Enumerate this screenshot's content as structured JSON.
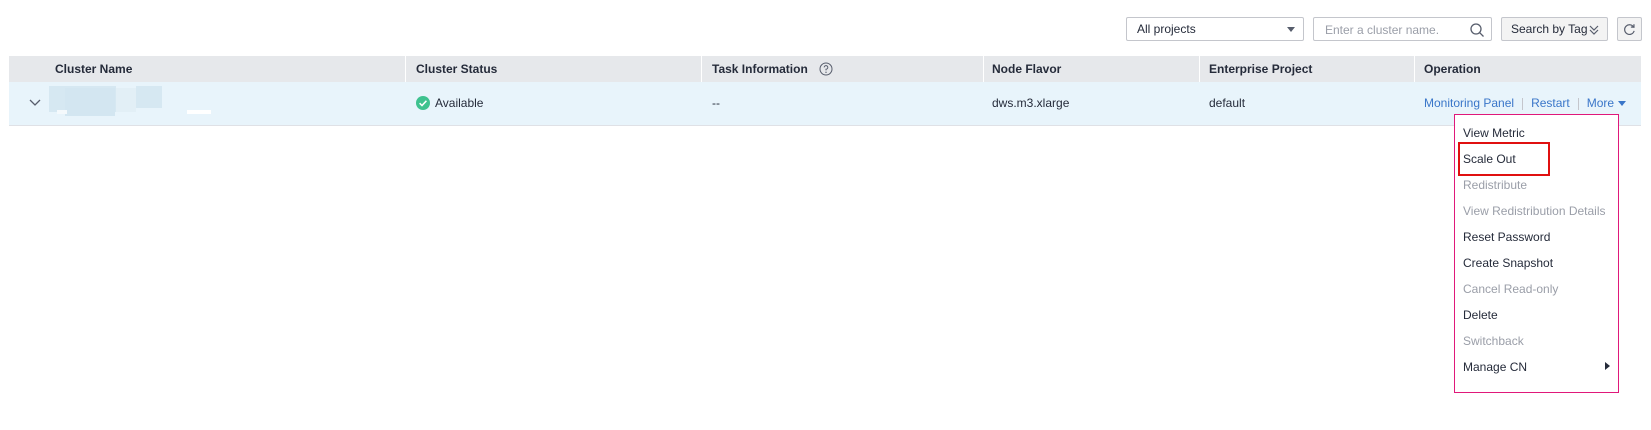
{
  "toolbar": {
    "project_select_value": "All projects",
    "search_placeholder": "Enter a cluster name.",
    "tag_button_label": "Search by Tag"
  },
  "table": {
    "columns": [
      "Cluster Name",
      "Cluster Status",
      "Task Information",
      "Node Flavor",
      "Enterprise Project",
      "Operation"
    ],
    "rows": [
      {
        "cluster_name": "",
        "status": "Available",
        "task_info": "--",
        "node_flavor": "dws.m3.xlarge",
        "enterprise_project": "default",
        "operations": [
          "Monitoring Panel",
          "Restart",
          "More"
        ]
      }
    ]
  },
  "more_menu": {
    "items": [
      {
        "label": "View Metric",
        "enabled": true
      },
      {
        "label": "Scale Out",
        "enabled": true,
        "highlighted": true
      },
      {
        "label": "Redistribute",
        "enabled": false
      },
      {
        "label": "View Redistribution Details",
        "enabled": false
      },
      {
        "label": "Reset Password",
        "enabled": true
      },
      {
        "label": "Create Snapshot",
        "enabled": true
      },
      {
        "label": "Cancel Read-only",
        "enabled": false
      },
      {
        "label": "Delete",
        "enabled": true
      },
      {
        "label": "Switchback",
        "enabled": false
      },
      {
        "label": "Manage CN",
        "enabled": true,
        "has_submenu": true
      }
    ]
  },
  "colors": {
    "accent_link": "#3a76c9",
    "status_available": "#3ec28f",
    "highlight_border": "#e01010",
    "menu_border": "#e0187a"
  },
  "icons": [
    "chevron-down-icon",
    "search-icon",
    "double-chevron-down-icon",
    "refresh-icon",
    "help-icon",
    "check-circle-icon",
    "caret-down-icon",
    "caret-right-icon"
  ]
}
